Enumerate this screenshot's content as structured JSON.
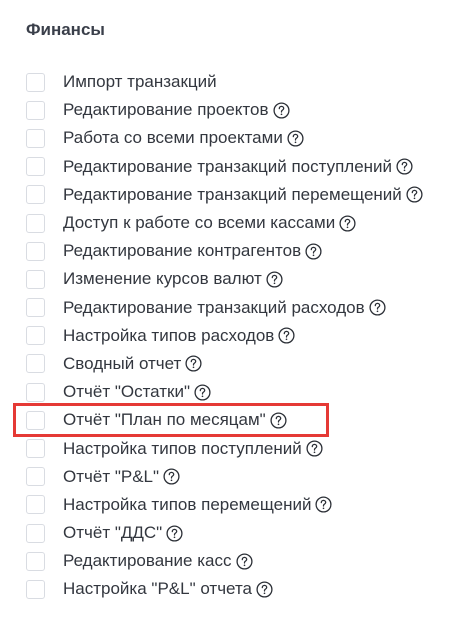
{
  "section": {
    "title": "Финансы"
  },
  "permissions": [
    {
      "label": "Импорт транзакций",
      "checked": false,
      "help": false
    },
    {
      "label": "Редактирование проектов",
      "checked": false,
      "help": true
    },
    {
      "label": "Работа со всеми проектами",
      "checked": false,
      "help": true
    },
    {
      "label": "Редактирование транзакций поступлений",
      "checked": false,
      "help": true
    },
    {
      "label": "Редактирование транзакций перемещений",
      "checked": false,
      "help": true
    },
    {
      "label": "Доступ к работе со всеми кассами",
      "checked": false,
      "help": true
    },
    {
      "label": "Редактирование контрагентов",
      "checked": false,
      "help": true
    },
    {
      "label": "Изменение курсов валют",
      "checked": false,
      "help": true
    },
    {
      "label": "Редактирование транзакций расходов",
      "checked": false,
      "help": true
    },
    {
      "label": "Настройка типов расходов",
      "checked": false,
      "help": true
    },
    {
      "label": "Сводный отчет",
      "checked": false,
      "help": true
    },
    {
      "label": "Отчёт \"Остатки\"",
      "checked": false,
      "help": true
    },
    {
      "label": "Отчёт \"План по месяцам\"",
      "checked": false,
      "help": true,
      "highlighted": true
    },
    {
      "label": "Настройка типов поступлений",
      "checked": false,
      "help": true
    },
    {
      "label": "Отчёт \"P&L\"",
      "checked": false,
      "help": true
    },
    {
      "label": "Настройка типов перемещений",
      "checked": false,
      "help": true
    },
    {
      "label": "Отчёт \"ДДС\"",
      "checked": false,
      "help": true
    },
    {
      "label": "Редактирование касс",
      "checked": false,
      "help": true
    },
    {
      "label": "Настройка \"P&L\" отчета",
      "checked": false,
      "help": true
    }
  ],
  "icons": {
    "help": "question-circle-icon",
    "checkbox": "checkbox-empty"
  },
  "colors": {
    "highlight": "#e53935",
    "text": "#33373f",
    "checkbox_border": "#d9dce2"
  }
}
